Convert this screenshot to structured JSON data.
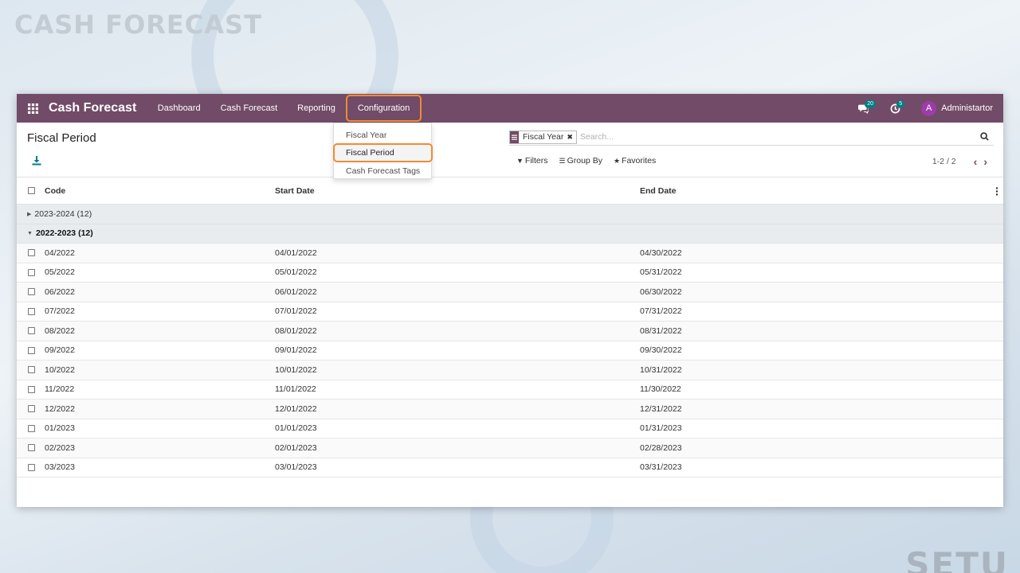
{
  "background": {
    "title": "CASH FORECAST",
    "logo": "SETU"
  },
  "navbar": {
    "apps_icon": "grid-icon",
    "brand": "Cash Forecast",
    "menu": [
      "Dashboard",
      "Cash Forecast",
      "Reporting",
      "Configuration"
    ],
    "messages_count": "20",
    "activities_count": "5",
    "user_initial": "A",
    "user_name": "Administartor",
    "color": "#714b67"
  },
  "dropdown": {
    "items": [
      "Fiscal Year",
      "Fiscal Period",
      "Cash Forecast Tags"
    ],
    "active": "Fiscal Period"
  },
  "control_panel": {
    "title": "Fiscal Period",
    "facet_label": "Fiscal Year",
    "search_placeholder": "Search...",
    "filters": "Filters",
    "group_by": "Group By",
    "favorites": "Favorites",
    "pager": "1-2 / 2"
  },
  "list": {
    "columns": {
      "code": "Code",
      "start": "Start Date",
      "end": "End Date"
    },
    "groups": [
      {
        "label": "2023-2024 (12)",
        "open": false
      },
      {
        "label": "2022-2023 (12)",
        "open": true
      }
    ],
    "rows": [
      {
        "code": "04/2022",
        "start": "04/01/2022",
        "end": "04/30/2022"
      },
      {
        "code": "05/2022",
        "start": "05/01/2022",
        "end": "05/31/2022"
      },
      {
        "code": "06/2022",
        "start": "06/01/2022",
        "end": "06/30/2022"
      },
      {
        "code": "07/2022",
        "start": "07/01/2022",
        "end": "07/31/2022"
      },
      {
        "code": "08/2022",
        "start": "08/01/2022",
        "end": "08/31/2022"
      },
      {
        "code": "09/2022",
        "start": "09/01/2022",
        "end": "09/30/2022"
      },
      {
        "code": "10/2022",
        "start": "10/01/2022",
        "end": "10/31/2022"
      },
      {
        "code": "11/2022",
        "start": "11/01/2022",
        "end": "11/30/2022"
      },
      {
        "code": "12/2022",
        "start": "12/01/2022",
        "end": "12/31/2022"
      },
      {
        "code": "01/2023",
        "start": "01/01/2023",
        "end": "01/31/2023"
      },
      {
        "code": "02/2023",
        "start": "02/01/2023",
        "end": "02/28/2023"
      },
      {
        "code": "03/2023",
        "start": "03/01/2023",
        "end": "03/31/2023"
      }
    ]
  },
  "accent_color": "#f28a34"
}
